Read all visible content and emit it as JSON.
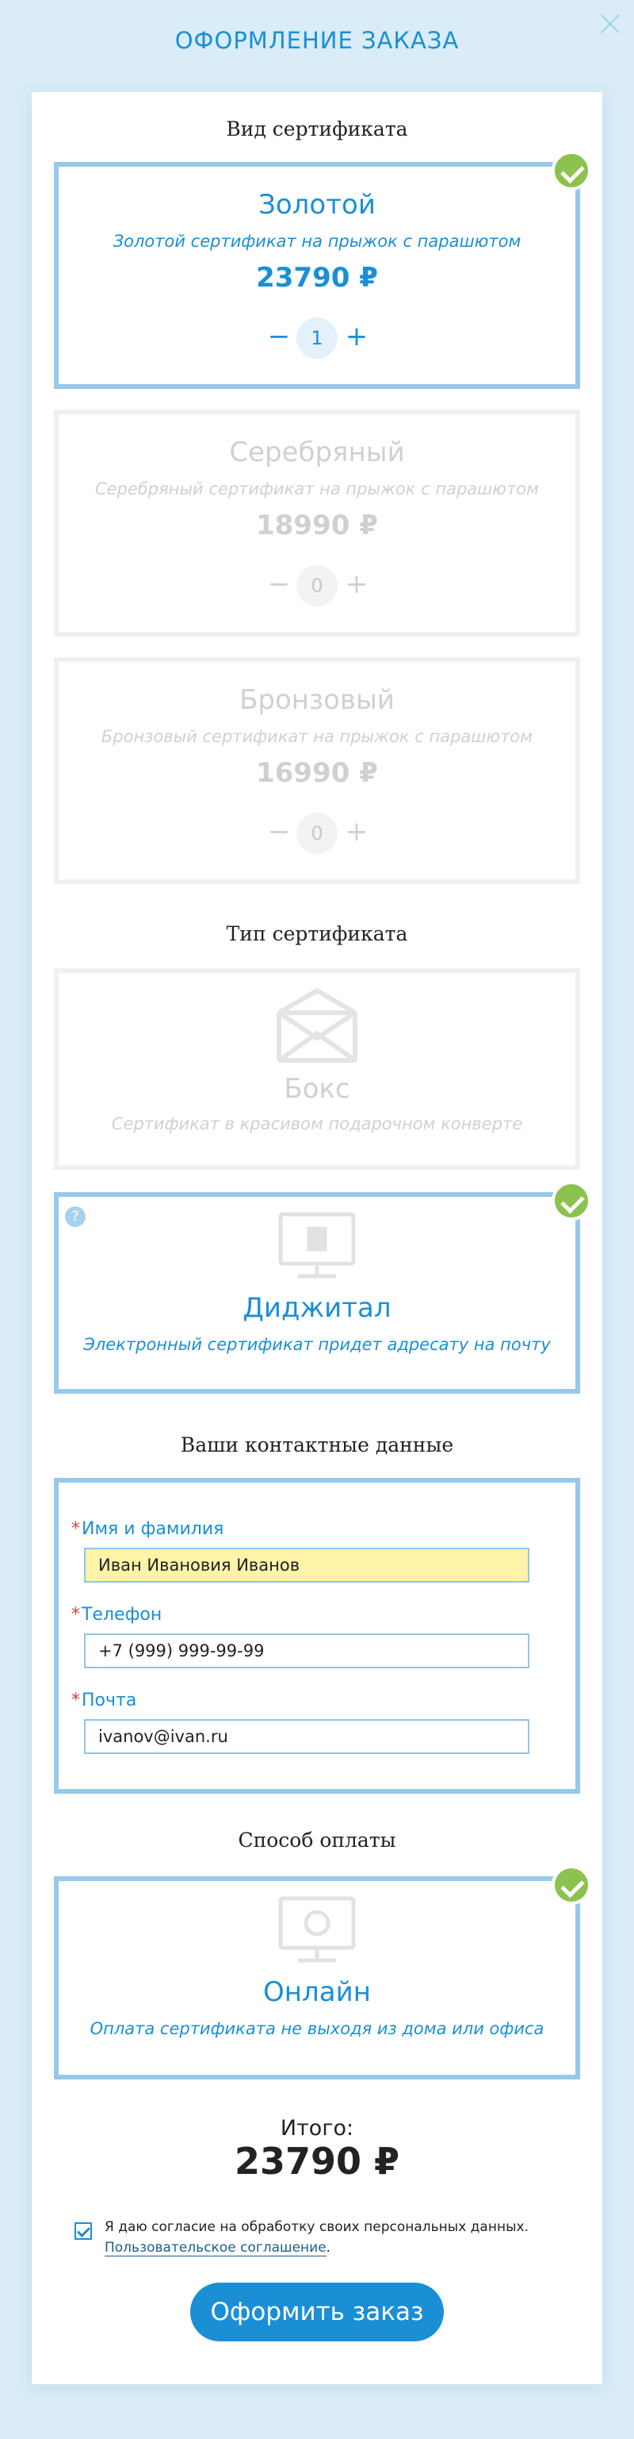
{
  "modal": {
    "title": "Оформление заказа",
    "close_label": ""
  },
  "sections": {
    "certificate_kind": "Вид сертификата",
    "certificate_type": "Тип сертификата",
    "contacts": "Ваши контактные данные",
    "payment": "Способ оплаты"
  },
  "certificates": [
    {
      "name": "Золотой",
      "description": "Золотой сертификат на прыжок с парашютом",
      "price": "23790 ₽",
      "quantity": "1",
      "selected": true
    },
    {
      "name": "Серебряный",
      "description": "Серебряный сертификат на прыжок с парашютом",
      "price": "18990 ₽",
      "quantity": "0",
      "selected": false
    },
    {
      "name": "Бронзовый",
      "description": "Бронзовый сертификат на прыжок с парашютом",
      "price": "16990 ₽",
      "quantity": "0",
      "selected": false
    }
  ],
  "qty_controls": {
    "minus": "−",
    "plus": "+"
  },
  "delivery_types": [
    {
      "name": "Бокс",
      "description": "Сертификат в красивом подарочном конверте",
      "icon": "envelope-icon",
      "selected": false
    },
    {
      "name": "Диджитал",
      "description": "Электронный сертификат придет адресату на почту",
      "icon": "monitor-icon",
      "help": "?",
      "selected": true
    }
  ],
  "form": {
    "required_mark": "*",
    "name": {
      "label": "Имя и фамилия",
      "value": "Иван Ивановия Иванов"
    },
    "phone": {
      "label": "Телефон",
      "value": "+7 (999) 999-99-99"
    },
    "email": {
      "label": "Почта",
      "value": "ivanov@ivan.ru"
    }
  },
  "payment": {
    "name": "Онлайн",
    "description": "Оплата сертификата не выходя из дома или офиса",
    "icon": "monitor-coin-icon",
    "selected": true
  },
  "total": {
    "label": "Итого:",
    "value": "23790 ₽"
  },
  "consent": {
    "checked": true,
    "text": "Я даю согласие на обработку своих персональных данных.",
    "link": "Пользовательское соглашение",
    "link_suffix": "."
  },
  "submit_label": "Оформить заказ",
  "colors": {
    "accent": "#1a8fd6",
    "selected_border": "#97c9ea",
    "check_green": "#8cc24e",
    "background": "#d9ecf7",
    "filled_field": "#fff3a8"
  }
}
